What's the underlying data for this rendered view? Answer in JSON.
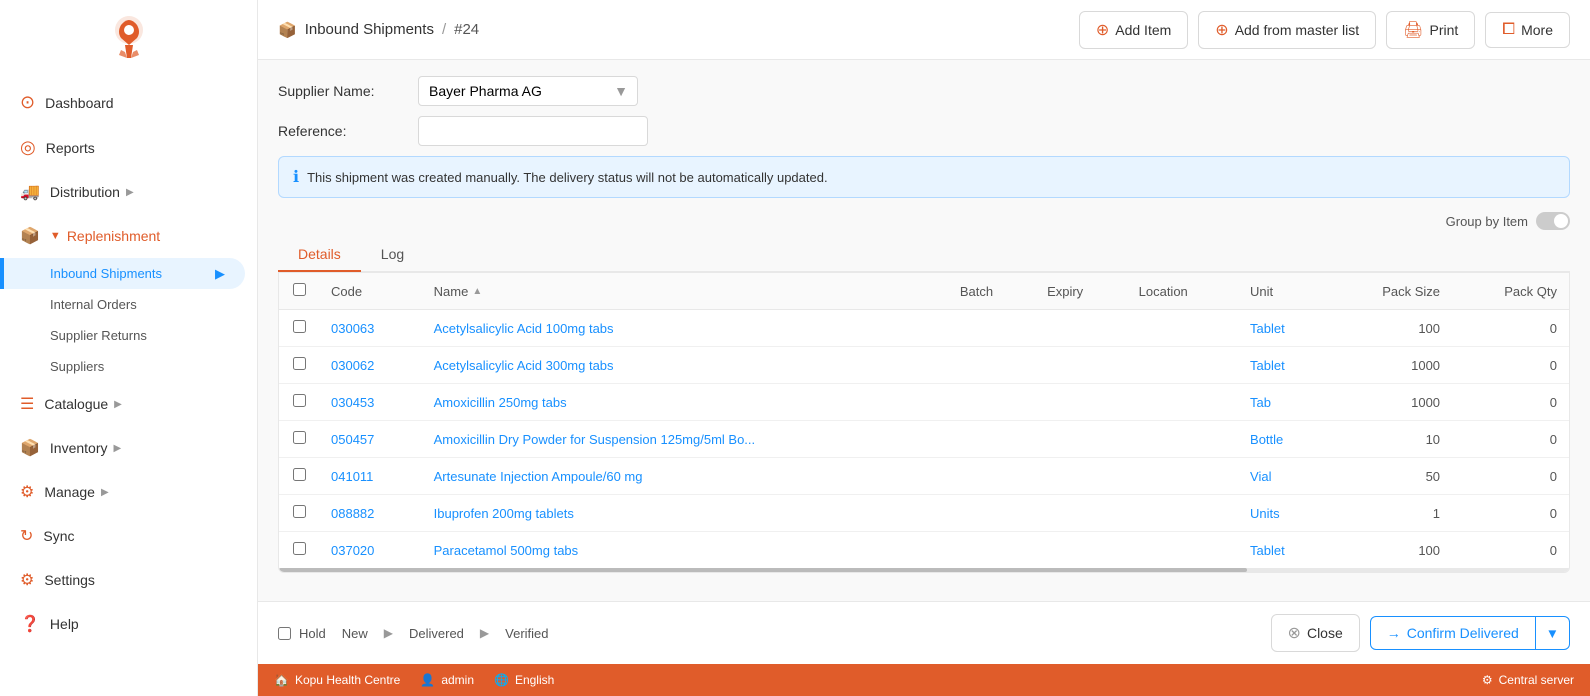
{
  "sidebar": {
    "items": [
      {
        "id": "dashboard",
        "label": "Dashboard",
        "icon": "⊙"
      },
      {
        "id": "reports",
        "label": "Reports",
        "icon": "◎"
      },
      {
        "id": "distribution",
        "label": "Distribution",
        "icon": "🚚",
        "hasChevron": true
      },
      {
        "id": "replenishment",
        "label": "Replenishment",
        "icon": "📦",
        "isExpanded": true
      },
      {
        "id": "catalogue",
        "label": "Catalogue",
        "icon": "📋",
        "hasChevron": true
      },
      {
        "id": "inventory",
        "label": "Inventory",
        "icon": "📦",
        "hasChevron": true
      },
      {
        "id": "manage",
        "label": "Manage",
        "icon": "⚙",
        "hasChevron": true
      },
      {
        "id": "sync",
        "label": "Sync",
        "icon": "↻"
      },
      {
        "id": "settings",
        "label": "Settings",
        "icon": "⚙"
      },
      {
        "id": "help",
        "label": "Help",
        "icon": "?"
      }
    ],
    "subItems": [
      {
        "id": "inbound-shipments",
        "label": "Inbound Shipments",
        "active": true
      },
      {
        "id": "internal-orders",
        "label": "Internal Orders"
      },
      {
        "id": "supplier-returns",
        "label": "Supplier Returns"
      },
      {
        "id": "suppliers",
        "label": "Suppliers"
      }
    ]
  },
  "header": {
    "breadcrumb_icon": "📦",
    "breadcrumb_parent": "Inbound Shipments",
    "breadcrumb_sep": "/",
    "breadcrumb_child": "#24",
    "btn_add_item": "Add Item",
    "btn_add_master": "Add from master list",
    "btn_print": "Print",
    "btn_more": "More"
  },
  "form": {
    "supplier_label": "Supplier Name:",
    "supplier_value": "Bayer Pharma AG",
    "reference_label": "Reference:"
  },
  "info_banner": {
    "text": "This shipment was created manually. The delivery status will not be automatically updated."
  },
  "group_by": {
    "label": "Group by Item"
  },
  "tabs": [
    {
      "id": "details",
      "label": "Details",
      "active": true
    },
    {
      "id": "log",
      "label": "Log"
    }
  ],
  "table": {
    "columns": [
      {
        "id": "code",
        "label": "Code"
      },
      {
        "id": "name",
        "label": "Name",
        "sortable": true
      },
      {
        "id": "batch",
        "label": "Batch"
      },
      {
        "id": "expiry",
        "label": "Expiry"
      },
      {
        "id": "location",
        "label": "Location"
      },
      {
        "id": "unit",
        "label": "Unit"
      },
      {
        "id": "pack_size",
        "label": "Pack Size"
      },
      {
        "id": "pack_qty",
        "label": "Pack Qty"
      }
    ],
    "rows": [
      {
        "code": "030063",
        "name": "Acetylsalicylic Acid 100mg tabs",
        "batch": "",
        "expiry": "",
        "location": "",
        "unit": "Tablet",
        "pack_size": "100",
        "pack_qty": "0"
      },
      {
        "code": "030062",
        "name": "Acetylsalicylic Acid 300mg tabs",
        "batch": "",
        "expiry": "",
        "location": "",
        "unit": "Tablet",
        "pack_size": "1000",
        "pack_qty": "0"
      },
      {
        "code": "030453",
        "name": "Amoxicillin 250mg tabs",
        "batch": "",
        "expiry": "",
        "location": "",
        "unit": "Tab",
        "pack_size": "1000",
        "pack_qty": "0"
      },
      {
        "code": "050457",
        "name": "Amoxicillin Dry Powder for Suspension 125mg/5ml Bo...",
        "batch": "",
        "expiry": "",
        "location": "",
        "unit": "Bottle",
        "pack_size": "10",
        "pack_qty": "0"
      },
      {
        "code": "041011",
        "name": "Artesunate Injection Ampoule/60 mg",
        "batch": "",
        "expiry": "",
        "location": "",
        "unit": "Vial",
        "pack_size": "50",
        "pack_qty": "0"
      },
      {
        "code": "088882",
        "name": "Ibuprofen 200mg tablets",
        "batch": "",
        "expiry": "",
        "location": "",
        "unit": "Units",
        "pack_size": "1",
        "pack_qty": "0"
      },
      {
        "code": "037020",
        "name": "Paracetamol 500mg tabs",
        "batch": "",
        "expiry": "",
        "location": "",
        "unit": "Tablet",
        "pack_size": "100",
        "pack_qty": "0"
      }
    ]
  },
  "confirm_bar": {
    "hold_label": "Hold",
    "step_new": "New",
    "step_delivered": "Delivered",
    "step_verified": "Verified",
    "btn_close": "Close",
    "btn_confirm": "Confirm Delivered"
  },
  "status_bar": {
    "facility": "Kopu Health Centre",
    "user": "admin",
    "language": "English",
    "server": "Central server"
  }
}
